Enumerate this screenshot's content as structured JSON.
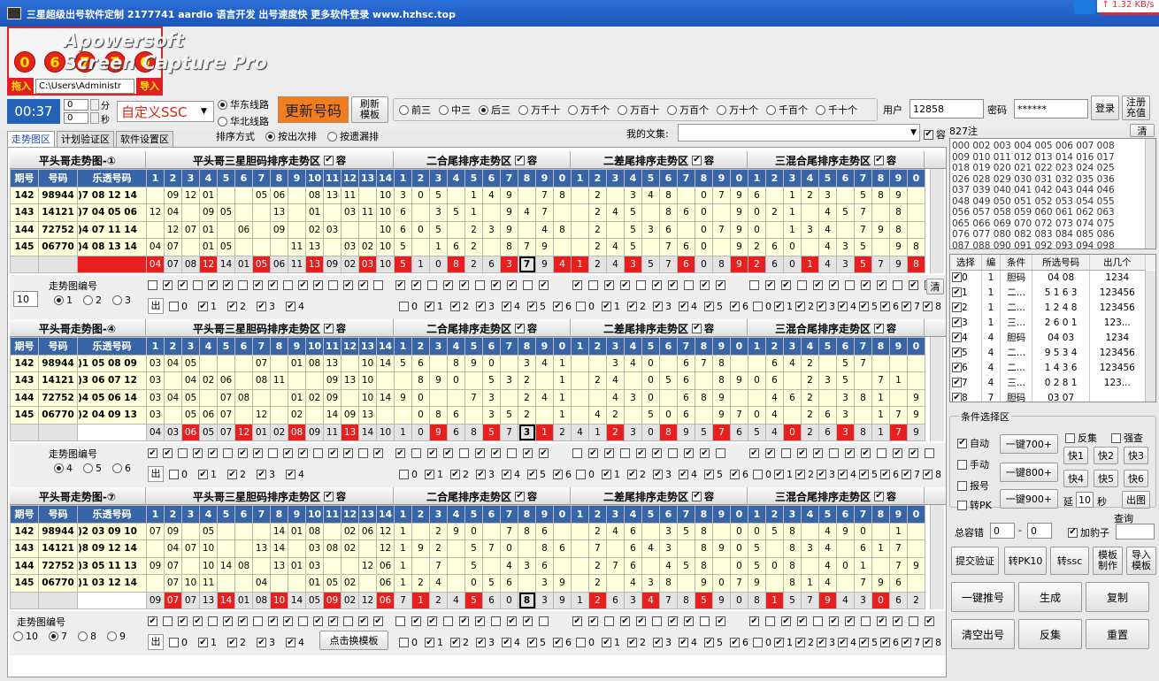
{
  "window": {
    "title": "三星超级出号软件定制 2177741 aardio 语言开发 出号速度快 更多软件登录 www.hzhsc.top",
    "speed": "↑ 1.32 KB/s"
  },
  "watermark": {
    "line1": "Apowersoft",
    "line2": "Screen Capture Pro"
  },
  "balls": [
    "0",
    "6",
    "7",
    "7",
    "0"
  ],
  "left": {
    "import_in": "拖入",
    "path": "C:\\Users\\Administr",
    "import": "导入",
    "time": "00:37",
    "minutes": "0",
    "seconds": "0",
    "min_label": "分",
    "sec_label": "秒"
  },
  "toolbar": {
    "lottery": "自定义SSC",
    "line_east": "华东线路",
    "line_north": "华北线路",
    "update": "更新号码",
    "refresh": "刷新模板",
    "sort_label": "排序方式",
    "sort_next": "按出次排",
    "sort_miss": "按遗漏排",
    "positions": [
      "前三",
      "中三",
      "后三",
      "万千十",
      "万千个",
      "万百十",
      "万百个",
      "万十个",
      "千百个",
      "千十个"
    ],
    "position_selected": 2,
    "user_label": "用户",
    "user": "12858",
    "pwd_label": "密码",
    "pwd": "******",
    "login": "登录",
    "recharge": "注册充值",
    "collection_label": "我的文集:",
    "rong": "容"
  },
  "tabs": [
    "走势图区",
    "计划验证区",
    "软件设置区"
  ],
  "sections": {
    "s1": "平头哥三星胆码排序走势区",
    "s2": "二合尾排序走势区",
    "s3": "二差尾排序走势区",
    "s4": "三混合尾排序走势区",
    "rong": "容"
  },
  "col_headers": {
    "period": "期号",
    "num": "号码",
    "arr": "乐透号码"
  },
  "digits1": [
    "1",
    "2",
    "3",
    "4",
    "5",
    "6",
    "7",
    "8",
    "9",
    "10",
    "11",
    "12",
    "13",
    "14"
  ],
  "digits2": [
    "1",
    "2",
    "3",
    "4",
    "5",
    "6",
    "7",
    "8",
    "9",
    "0"
  ],
  "panels": [
    {
      "title": "平头哥走势图-①",
      "label": "走势图编号",
      "opts": [
        "1",
        "2",
        "3"
      ],
      "sel": 0,
      "spin": "10",
      "rows": [
        [
          "142",
          "98944",
          ")7 08 12 14"
        ],
        [
          "143",
          "14121",
          ")7 04 05 06"
        ],
        [
          "144",
          "72752",
          ")4 07 11 14"
        ],
        [
          "145",
          "06770",
          ")4 08 13 14"
        ]
      ],
      "s1": [
        [
          "04",
          "09",
          "12",
          "01",
          "02",
          "03",
          "05",
          "06",
          "07",
          "08",
          "13",
          "11",
          "14",
          "10"
        ],
        [
          "12",
          "04",
          "07",
          "09",
          "05",
          "06",
          "08",
          "13",
          "14",
          "01",
          "02",
          "03",
          "11",
          "10"
        ],
        [
          "04",
          "12",
          "07",
          "01",
          "05",
          "06",
          "08",
          "09",
          "13",
          "02",
          "03",
          "11",
          "14",
          "10"
        ],
        [
          "04",
          "07",
          "12",
          "01",
          "05",
          "06",
          "08",
          "09",
          "11",
          "13",
          "14",
          "03",
          "02",
          "10"
        ],
        [
          "04",
          "07",
          "08",
          "12",
          "14",
          "01",
          "05",
          "06",
          "11",
          "13",
          "09",
          "02",
          "03",
          "10"
        ]
      ],
      "s2": [
        [
          "3",
          "0",
          "5",
          "6",
          "1",
          "4",
          "9",
          "2",
          "7",
          "8"
        ],
        [
          "6",
          "0",
          "3",
          "5",
          "1",
          "2",
          "9",
          "4",
          "7",
          "8"
        ],
        [
          "6",
          "0",
          "5",
          "1",
          "2",
          "3",
          "9",
          "7",
          "4",
          "8"
        ],
        [
          "5",
          "0",
          "1",
          "6",
          "2",
          "3",
          "8",
          "7",
          "9",
          "4"
        ],
        [
          "5",
          "1",
          "0",
          "8",
          "2",
          "6",
          "3",
          "7",
          "9",
          "4"
        ]
      ],
      "s3": [
        [
          "1",
          "2",
          "5",
          "3",
          "4",
          "8",
          "6",
          "0",
          "7",
          "9"
        ],
        [
          "1",
          "2",
          "4",
          "5",
          "3",
          "8",
          "6",
          "0",
          "7",
          "9"
        ],
        [
          "1",
          "2",
          "4",
          "5",
          "3",
          "6",
          "8",
          "0",
          "7",
          "9"
        ],
        [
          "1",
          "2",
          "4",
          "5",
          "3",
          "7",
          "6",
          "0",
          "8",
          "9"
        ],
        [
          "1",
          "2",
          "4",
          "3",
          "5",
          "7",
          "6",
          "0",
          "8",
          "9"
        ]
      ],
      "s4": [
        [
          "6",
          "0",
          "1",
          "2",
          "3",
          "4",
          "5",
          "8",
          "9",
          "7"
        ],
        [
          "0",
          "2",
          "1",
          "3",
          "4",
          "5",
          "7",
          "9",
          "8",
          "6"
        ],
        [
          "0",
          "2",
          "1",
          "3",
          "4",
          "5",
          "7",
          "9",
          "8",
          "6"
        ],
        [
          "2",
          "6",
          "0",
          "1",
          "4",
          "3",
          "5",
          "7",
          "9",
          "8"
        ],
        [
          "2",
          "6",
          "0",
          "1",
          "4",
          "3",
          "5",
          "7",
          "9",
          "8"
        ]
      ]
    },
    {
      "title": "平头哥走势图-④",
      "label": "走势图编号",
      "opts": [
        "4",
        "5",
        "6"
      ],
      "sel": 0,
      "spin": "",
      "rows": [
        [
          "142",
          "98944",
          ")1 05 08 09"
        ],
        [
          "143",
          "14121",
          ")3 06 07 12"
        ],
        [
          "144",
          "72752",
          ")4 05 06 14"
        ],
        [
          "145",
          "06770",
          ")2 04 09 13"
        ]
      ],
      "s1": [
        [
          "03",
          "04",
          "05",
          "11",
          "02",
          "06",
          "07",
          "12",
          "01",
          "08",
          "13",
          "09",
          "10",
          "14"
        ],
        [
          "03",
          "05",
          "04",
          "02",
          "06",
          "07",
          "08",
          "11",
          "12",
          "01",
          "09",
          "13",
          "10",
          "14"
        ],
        [
          "03",
          "04",
          "05",
          "06",
          "07",
          "08",
          "11",
          "12",
          "01",
          "02",
          "09",
          "13",
          "10",
          "14"
        ],
        [
          "03",
          "04",
          "05",
          "06",
          "07",
          "11",
          "12",
          "01",
          "02",
          "08",
          "14",
          "09",
          "13",
          "10"
        ],
        [
          "04",
          "03",
          "06",
          "05",
          "07",
          "12",
          "01",
          "02",
          "08",
          "09",
          "11",
          "13",
          "14",
          "10"
        ]
      ],
      "s2": [
        [
          "5",
          "6",
          "7",
          "8",
          "9",
          "0",
          "2",
          "3",
          "4",
          "1"
        ],
        [
          "7",
          "8",
          "9",
          "0",
          "6",
          "5",
          "3",
          "2",
          "4",
          "1"
        ],
        [
          "9",
          "0",
          "8",
          "6",
          "7",
          "3",
          "5",
          "2",
          "4",
          "1"
        ],
        [
          "9",
          "0",
          "8",
          "6",
          "7",
          "3",
          "5",
          "2",
          "4",
          "1"
        ],
        [
          "1",
          "0",
          "9",
          "6",
          "8",
          "5",
          "7",
          "3",
          "1",
          "2"
        ]
      ],
      "s3": [
        [
          "1",
          "2",
          "3",
          "4",
          "0",
          "5",
          "6",
          "7",
          "8",
          "9"
        ],
        [
          "1",
          "2",
          "4",
          "3",
          "0",
          "5",
          "6",
          "7",
          "8",
          "9"
        ],
        [
          "1",
          "2",
          "4",
          "3",
          "0",
          "5",
          "6",
          "8",
          "9",
          "7"
        ],
        [
          "1",
          "4",
          "2",
          "3",
          "5",
          "0",
          "6",
          "8",
          "9",
          "7"
        ],
        [
          "4",
          "1",
          "2",
          "3",
          "0",
          "8",
          "9",
          "5",
          "7",
          "6"
        ]
      ],
      "s4": [
        [
          "0",
          "6",
          "4",
          "2",
          "3",
          "5",
          "7",
          "8",
          "1",
          "9"
        ],
        [
          "0",
          "6",
          "4",
          "2",
          "3",
          "5",
          "8",
          "7",
          "1",
          "9"
        ],
        [
          "0",
          "4",
          "6",
          "2",
          "5",
          "3",
          "8",
          "1",
          "7",
          "9"
        ],
        [
          "0",
          "4",
          "5",
          "2",
          "6",
          "3",
          "8",
          "1",
          "7",
          "9"
        ],
        [
          "5",
          "4",
          "0",
          "2",
          "6",
          "3",
          "8",
          "1",
          "7",
          "9"
        ]
      ]
    },
    {
      "title": "平头哥走势图-⑦",
      "label": "走势图编号",
      "opts": [
        "10",
        "7",
        "8",
        "9"
      ],
      "sel": 1,
      "spin": "",
      "rows": [
        [
          "142",
          "98944",
          ")2 03 09 10"
        ],
        [
          "143",
          "14121",
          ")8 09 12 14"
        ],
        [
          "144",
          "72752",
          ")3 05 11 13"
        ],
        [
          "145",
          "06770",
          ")1 03 12 14"
        ]
      ],
      "s1": [
        [
          "07",
          "09",
          "04",
          "05",
          "10",
          "13",
          "11",
          "14",
          "01",
          "08",
          "03",
          "02",
          "06",
          "12"
        ],
        [
          "09",
          "04",
          "07",
          "10",
          "05",
          "11",
          "13",
          "14",
          "01",
          "03",
          "08",
          "02",
          "06",
          "12"
        ],
        [
          "09",
          "07",
          "04",
          "10",
          "14",
          "08",
          "11",
          "13",
          "01",
          "03",
          "05",
          "02",
          "12",
          "06"
        ],
        [
          "09",
          "07",
          "10",
          "11",
          "13",
          "03",
          "04",
          "08",
          "14",
          "01",
          "05",
          "02",
          "12",
          "06"
        ],
        [
          "09",
          "07",
          "07",
          "13",
          "14",
          "01",
          "08",
          "10",
          "14",
          "05",
          "09",
          "02",
          "12",
          "06"
        ]
      ],
      "s2": [
        [
          "1",
          "4",
          "2",
          "9",
          "0",
          "5",
          "7",
          "8",
          "6",
          "3"
        ],
        [
          "1",
          "9",
          "2",
          "4",
          "5",
          "7",
          "0",
          "3",
          "8",
          "6"
        ],
        [
          "1",
          "2",
          "7",
          "0",
          "5",
          "9",
          "4",
          "3",
          "6",
          "8"
        ],
        [
          "1",
          "2",
          "4",
          "7",
          "0",
          "5",
          "6",
          "8",
          "3",
          "9"
        ],
        [
          "7",
          "1",
          "2",
          "4",
          "5",
          "6",
          "0",
          "8",
          "3",
          "9"
        ]
      ],
      "s3": [
        [
          "1",
          "2",
          "4",
          "6",
          "7",
          "3",
          "5",
          "8",
          "9",
          "0"
        ],
        [
          "1",
          "7",
          "2",
          "6",
          "4",
          "3",
          "5",
          "8",
          "9",
          "0"
        ],
        [
          "1",
          "2",
          "7",
          "6",
          "3",
          "4",
          "5",
          "8",
          "9",
          "0"
        ],
        [
          "1",
          "2",
          "6",
          "4",
          "3",
          "8",
          "5",
          "9",
          "0",
          "7"
        ],
        [
          "1",
          "2",
          "6",
          "3",
          "4",
          "7",
          "8",
          "5",
          "9",
          "0"
        ]
      ],
      "s4": [
        [
          "0",
          "5",
          "8",
          "3",
          "4",
          "9",
          "0",
          "6",
          "1",
          "7"
        ],
        [
          "5",
          "0",
          "8",
          "3",
          "4",
          "9",
          "6",
          "1",
          "7",
          "2"
        ],
        [
          "5",
          "0",
          "8",
          "3",
          "4",
          "0",
          "1",
          "6",
          "7",
          "9"
        ],
        [
          "9",
          "5",
          "8",
          "1",
          "4",
          "3",
          "7",
          "9",
          "6",
          "2"
        ],
        [
          "8",
          "1",
          "5",
          "7",
          "9",
          "4",
          "3",
          "0",
          "6",
          "2"
        ]
      ]
    }
  ],
  "ctl": {
    "out": "出",
    "chk_nums": [
      "0",
      "1",
      "2",
      "3",
      "4"
    ],
    "chk_nums10": [
      "0",
      "1",
      "2",
      "3",
      "4",
      "5",
      "6"
    ],
    "chk_nums8": [
      "0",
      "1",
      "2",
      "3",
      "4",
      "5",
      "6",
      "7",
      "8"
    ],
    "switch_tpl": "点击换模板",
    "clear": "清"
  },
  "right": {
    "count": "827注",
    "clear": "清",
    "numbers": "000 002 003 004 005 006 007 008\n009 010 011 012 013 014 016 017\n018 019 020 021 022 023 024 025\n026 028 029 030 031 032 035 036\n037 039 040 041 042 043 044 046\n048 049 050 051 052 053 054 055\n056 057 058 059 060 061 062 063\n065 066 069 070 072 073 074 075\n076 077 080 082 083 084 085 086\n087 088 090 091 092 093 094 098",
    "table_head": [
      "选择",
      "编",
      "条件",
      "所选号码",
      "出几个"
    ],
    "table": [
      [
        "0",
        "1",
        "胆码",
        "04 08",
        "1234"
      ],
      [
        "1",
        "1",
        "二...",
        "5 1 6 3",
        "123456"
      ],
      [
        "2",
        "1",
        "二...",
        "1 2 4 8",
        "123456"
      ],
      [
        "3",
        "1",
        "三...",
        "2 6 0 1",
        "123..."
      ],
      [
        "4",
        "4",
        "胆码",
        "04 03",
        "1234"
      ],
      [
        "5",
        "4",
        "二...",
        "9 5 3 4",
        "123456"
      ],
      [
        "6",
        "4",
        "二...",
        "1 4 3 6",
        "123456"
      ],
      [
        "7",
        "4",
        "三...",
        "0 2 8 1",
        "123..."
      ],
      [
        "8",
        "7",
        "胆码",
        "03 07",
        ""
      ]
    ],
    "cond_title": "条件选择区",
    "auto": "自动",
    "manual": "手动",
    "report": "报号",
    "pk": "转PK",
    "k700": "一键700+",
    "k800": "一键800+",
    "k900": "一键900+",
    "fanji": "反集",
    "qiangcha": "强查",
    "fast": [
      "快1",
      "快2",
      "快3",
      "快4",
      "快5",
      "快6"
    ],
    "yan": "延",
    "yan_val": "10",
    "sec": "秒",
    "chart": "出图",
    "query": "查询",
    "total_err": "总容错",
    "e1": "0",
    "e2": "0",
    "dash": "-",
    "jiayun": "加豹子",
    "verify": "提交验证",
    "topk": "转PK10",
    "tossc": "转ssc",
    "tpl_make": "模板制作",
    "tpl_import": "导入模板",
    "one_key": "一键推号",
    "gen": "生成",
    "copy": "复制",
    "clear_out": "清空出号",
    "fanji2": "反集",
    "reset": "重置"
  }
}
